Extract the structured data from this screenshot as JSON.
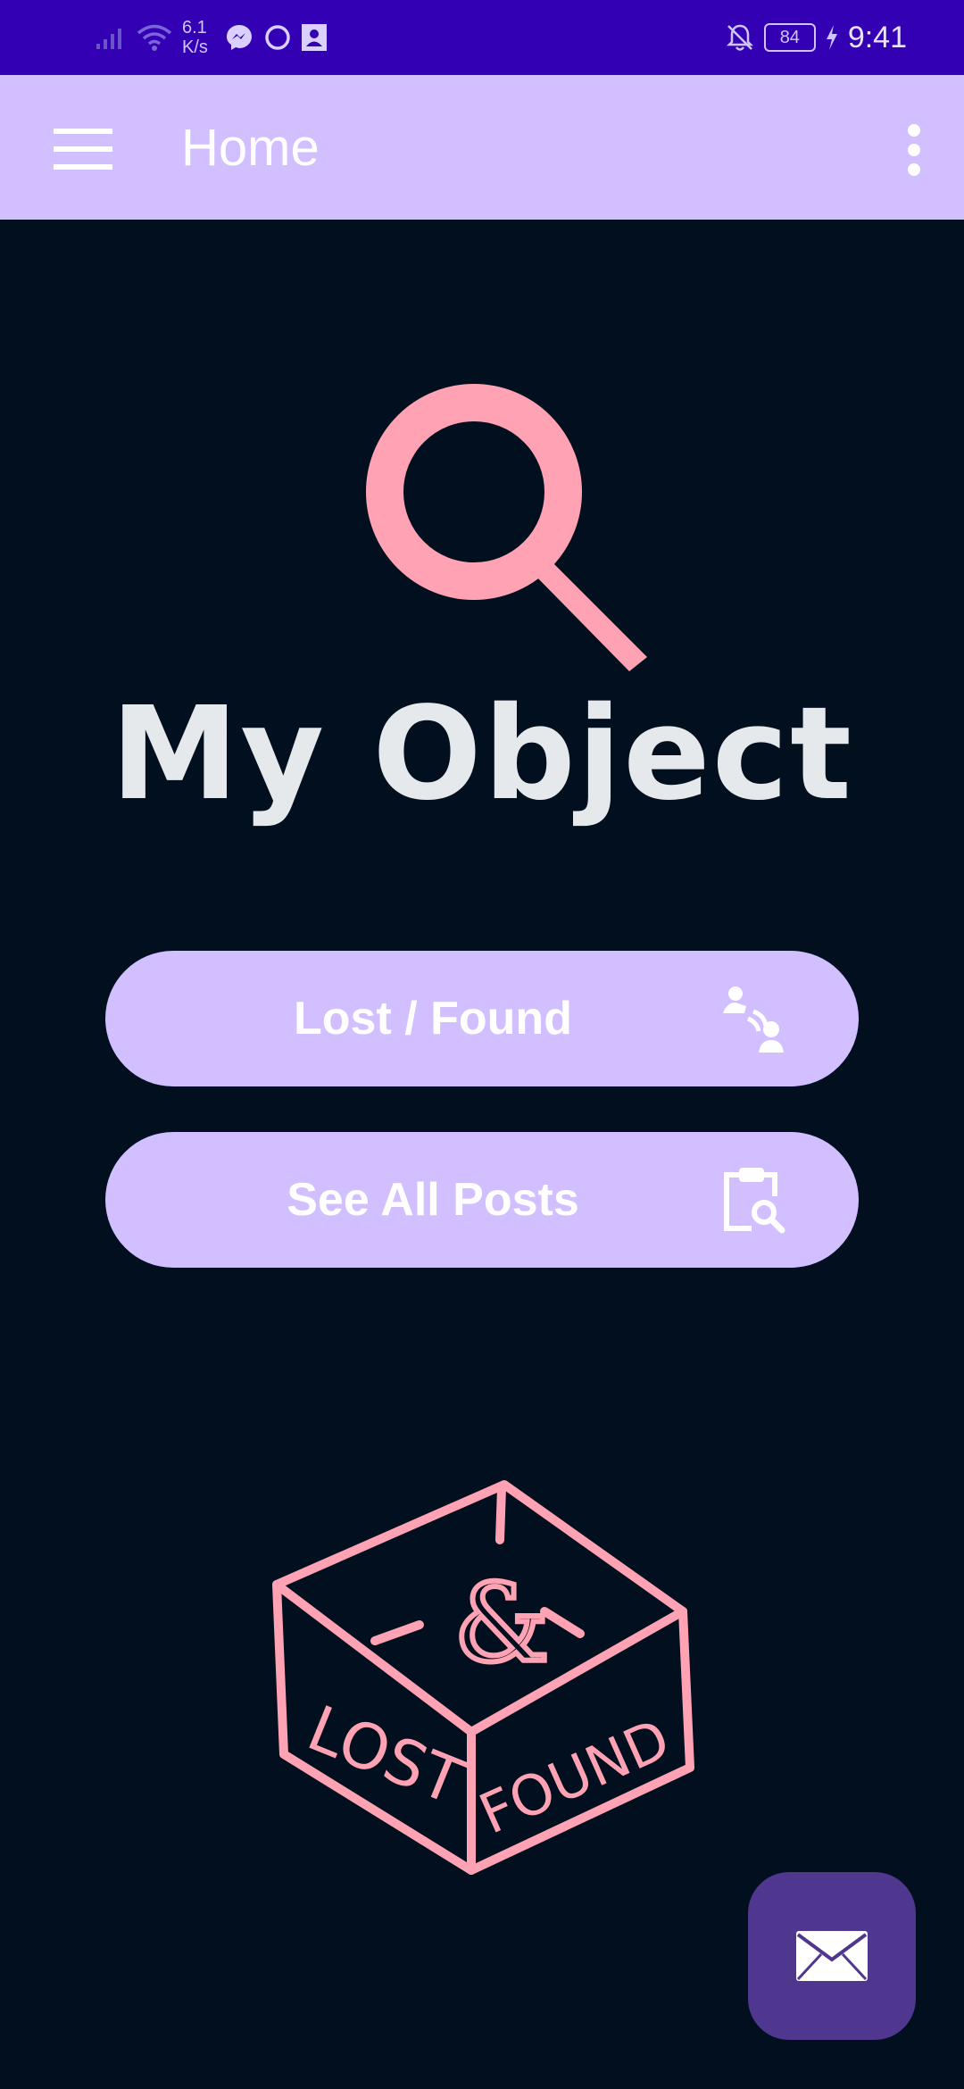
{
  "status_bar": {
    "net_speed_value": "6.1",
    "net_speed_unit": "K/s",
    "battery": "84",
    "time": "9:41",
    "icons": [
      "signal-icon",
      "wifi-icon",
      "messenger-icon",
      "sync-icon",
      "contacts-icon",
      "bell-off-icon",
      "charging-icon"
    ]
  },
  "app_bar": {
    "title": "Home",
    "menu_icon": "hamburger-menu-icon",
    "overflow_icon": "more-vert-icon"
  },
  "main": {
    "logo_icon": "magnifier-icon",
    "app_name": "My Object",
    "buttons": [
      {
        "label": "Lost / Found",
        "icon": "people-search-icon"
      },
      {
        "label": "See All Posts",
        "icon": "clipboard-search-icon"
      }
    ],
    "illustration": {
      "text_lost": "LOST",
      "text_amp": "&",
      "text_found": "FOUND"
    }
  },
  "fab": {
    "icon": "mail-icon"
  },
  "colors": {
    "status_bar": "#3400b3",
    "app_bar": "#d1bfff",
    "background": "#020f1e",
    "accent_pink": "#ffa3b4",
    "fab": "#4f368e",
    "title_text": "#e6e9ec"
  }
}
